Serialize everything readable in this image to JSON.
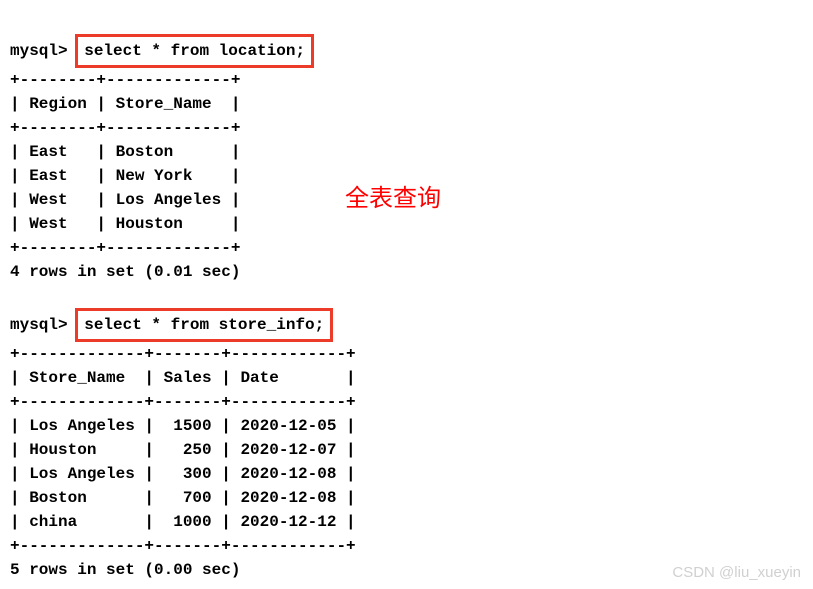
{
  "query1": {
    "prompt": "mysql>",
    "sql": "select * from location;",
    "border_top": "+--------+-------------+",
    "header": "| Region | Store_Name  |",
    "rows": [
      "| East   | Boston      |",
      "| East   | New York    |",
      "| West   | Los Angeles |",
      "| West   | Houston     |"
    ],
    "footer": "4 rows in set (0.01 sec)"
  },
  "query2": {
    "prompt": "mysql>",
    "sql": "select * from store_info;",
    "border_top": "+-------------+-------+------------+",
    "header": "| Store_Name  | Sales | Date       |",
    "rows": [
      "| Los Angeles |  1500 | 2020-12-05 |",
      "| Houston     |   250 | 2020-12-07 |",
      "| Los Angeles |   300 | 2020-12-08 |",
      "| Boston      |   700 | 2020-12-08 |",
      "| china       |  1000 | 2020-12-12 |"
    ],
    "footer": "5 rows in set (0.00 sec)"
  },
  "annotation": "全表查询",
  "watermark": "CSDN @liu_xueyin",
  "chart_data": [
    {
      "type": "table",
      "title": "location",
      "columns": [
        "Region",
        "Store_Name"
      ],
      "rows": [
        [
          "East",
          "Boston"
        ],
        [
          "East",
          "New York"
        ],
        [
          "West",
          "Los Angeles"
        ],
        [
          "West",
          "Houston"
        ]
      ]
    },
    {
      "type": "table",
      "title": "store_info",
      "columns": [
        "Store_Name",
        "Sales",
        "Date"
      ],
      "rows": [
        [
          "Los Angeles",
          1500,
          "2020-12-05"
        ],
        [
          "Houston",
          250,
          "2020-12-07"
        ],
        [
          "Los Angeles",
          300,
          "2020-12-08"
        ],
        [
          "Boston",
          700,
          "2020-12-08"
        ],
        [
          "china",
          1000,
          "2020-12-12"
        ]
      ]
    }
  ]
}
